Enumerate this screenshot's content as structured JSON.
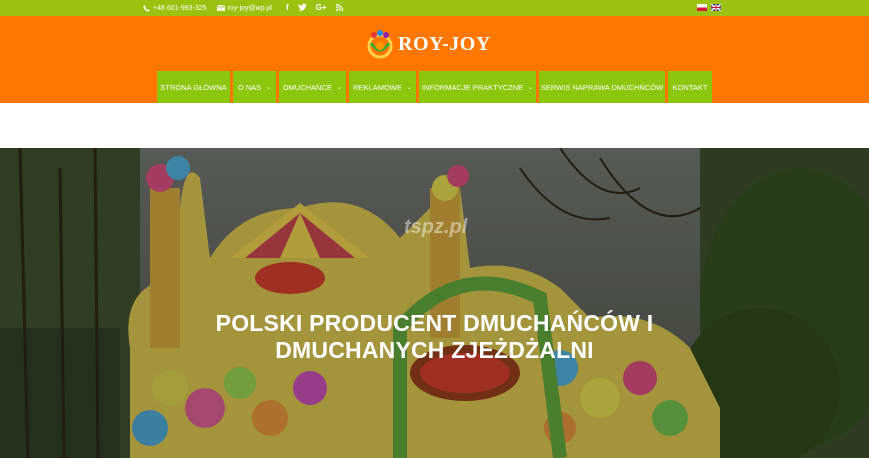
{
  "topbar": {
    "phone": "+48 601-993-325",
    "email": "roy-joy@wp.pl",
    "social": [
      "facebook-icon",
      "twitter-icon",
      "google-plus-icon",
      "rss-icon"
    ],
    "languages": [
      "pl",
      "en"
    ]
  },
  "header": {
    "logo_text": "ROY-JOY"
  },
  "nav": {
    "items": [
      {
        "label": "STRONA GŁÓWNA",
        "dropdown": false
      },
      {
        "label": "O NAS",
        "dropdown": true
      },
      {
        "label": "DMUCHAŃCE",
        "dropdown": true
      },
      {
        "label": "REKLAMOWE",
        "dropdown": true
      },
      {
        "label": "INFORMACJE PRAKTYCZNE",
        "dropdown": true
      },
      {
        "label": "SERWIS NAPRAWA DMUCHŃCÓW",
        "dropdown": false
      },
      {
        "label": "KONTAKT",
        "dropdown": false
      }
    ]
  },
  "hero": {
    "watermark": "tspz.pl",
    "title_line1": "POLSKI PRODUCENT DMUCHAŃCÓW I",
    "title_line2": "DMUCHANYCH ZJEŻDŻALNI"
  },
  "colors": {
    "topbar": "#9bc20f",
    "header": "#ff7700",
    "nav_item": "#8cc70d"
  }
}
